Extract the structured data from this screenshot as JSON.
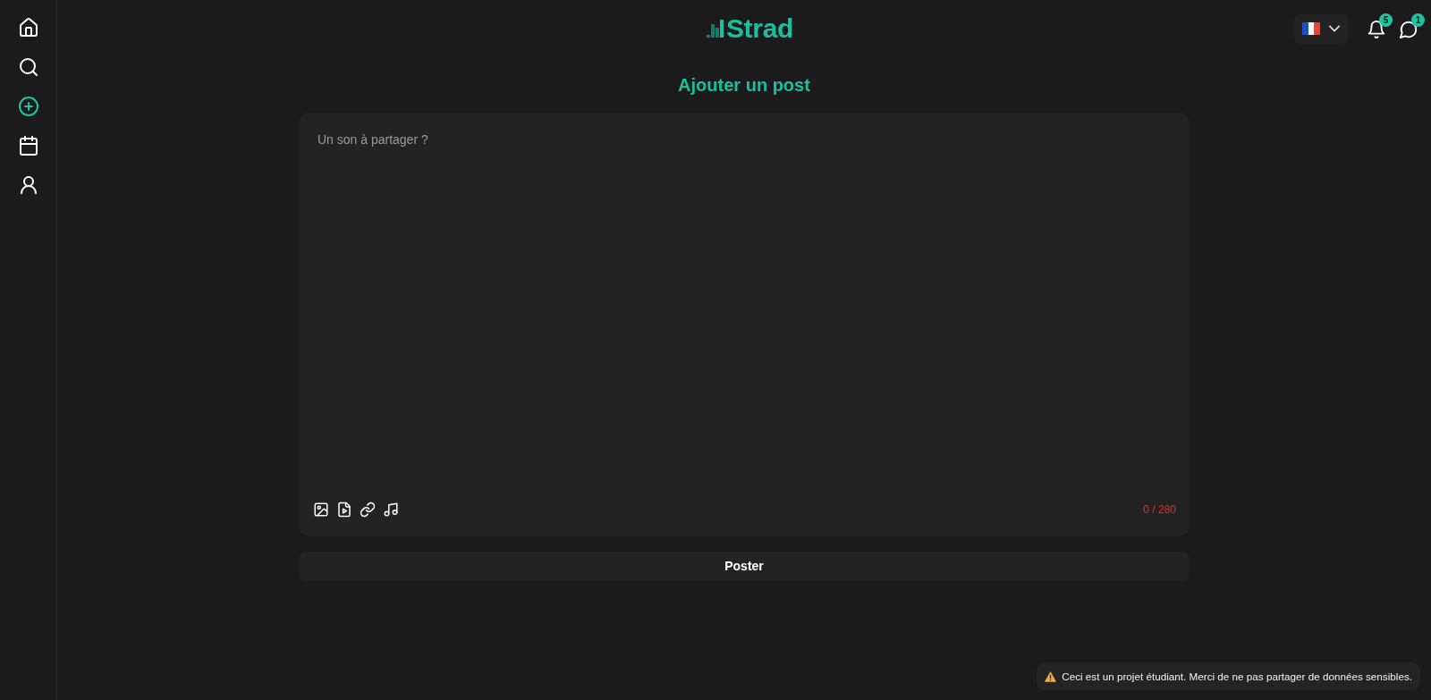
{
  "sidebar": {
    "items": [
      {
        "kind": "home",
        "selected": false
      },
      {
        "kind": "search",
        "selected": false
      },
      {
        "kind": "add",
        "selected": true
      },
      {
        "kind": "calendar",
        "selected": false
      },
      {
        "kind": "profile",
        "selected": false
      }
    ]
  },
  "header": {
    "logo": {
      "text": "Strad"
    },
    "actions": [
      {
        "kind": "notifications",
        "badge": "5"
      },
      {
        "kind": "messages",
        "badge": "1"
      }
    ]
  },
  "page_title": "Ajouter un post",
  "composer": {
    "placeholder": "Un son à partager ?",
    "tools": [
      {
        "kind": "image"
      },
      {
        "kind": "video"
      },
      {
        "kind": "link"
      },
      {
        "kind": "music"
      }
    ],
    "counter": "0 / 280"
  },
  "submit_button": {
    "label": "Poster"
  },
  "notice": {
    "text": "Ceci est un projet étudiant. Merci de ne pas partager de données sensibles."
  }
}
